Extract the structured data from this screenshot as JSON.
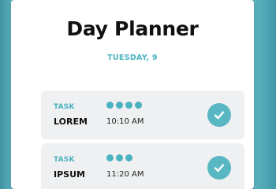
{
  "app": {
    "title": "Day Planner",
    "date": "TUESDAY, 9"
  },
  "tasks": [
    {
      "label": "TASK",
      "name": "LOREM",
      "time": "10:10 AM",
      "priority": 4,
      "completed": true
    },
    {
      "label": "TASK",
      "name": "IPSUM",
      "time": "11:20 AM",
      "priority": 3,
      "completed": true
    }
  ],
  "icons": {
    "complete": "check-circle-icon",
    "priority": "dot-icon"
  },
  "colors": {
    "accent": "#4ab2c0",
    "background": "#5aaeba",
    "card": "#eef0f1"
  }
}
